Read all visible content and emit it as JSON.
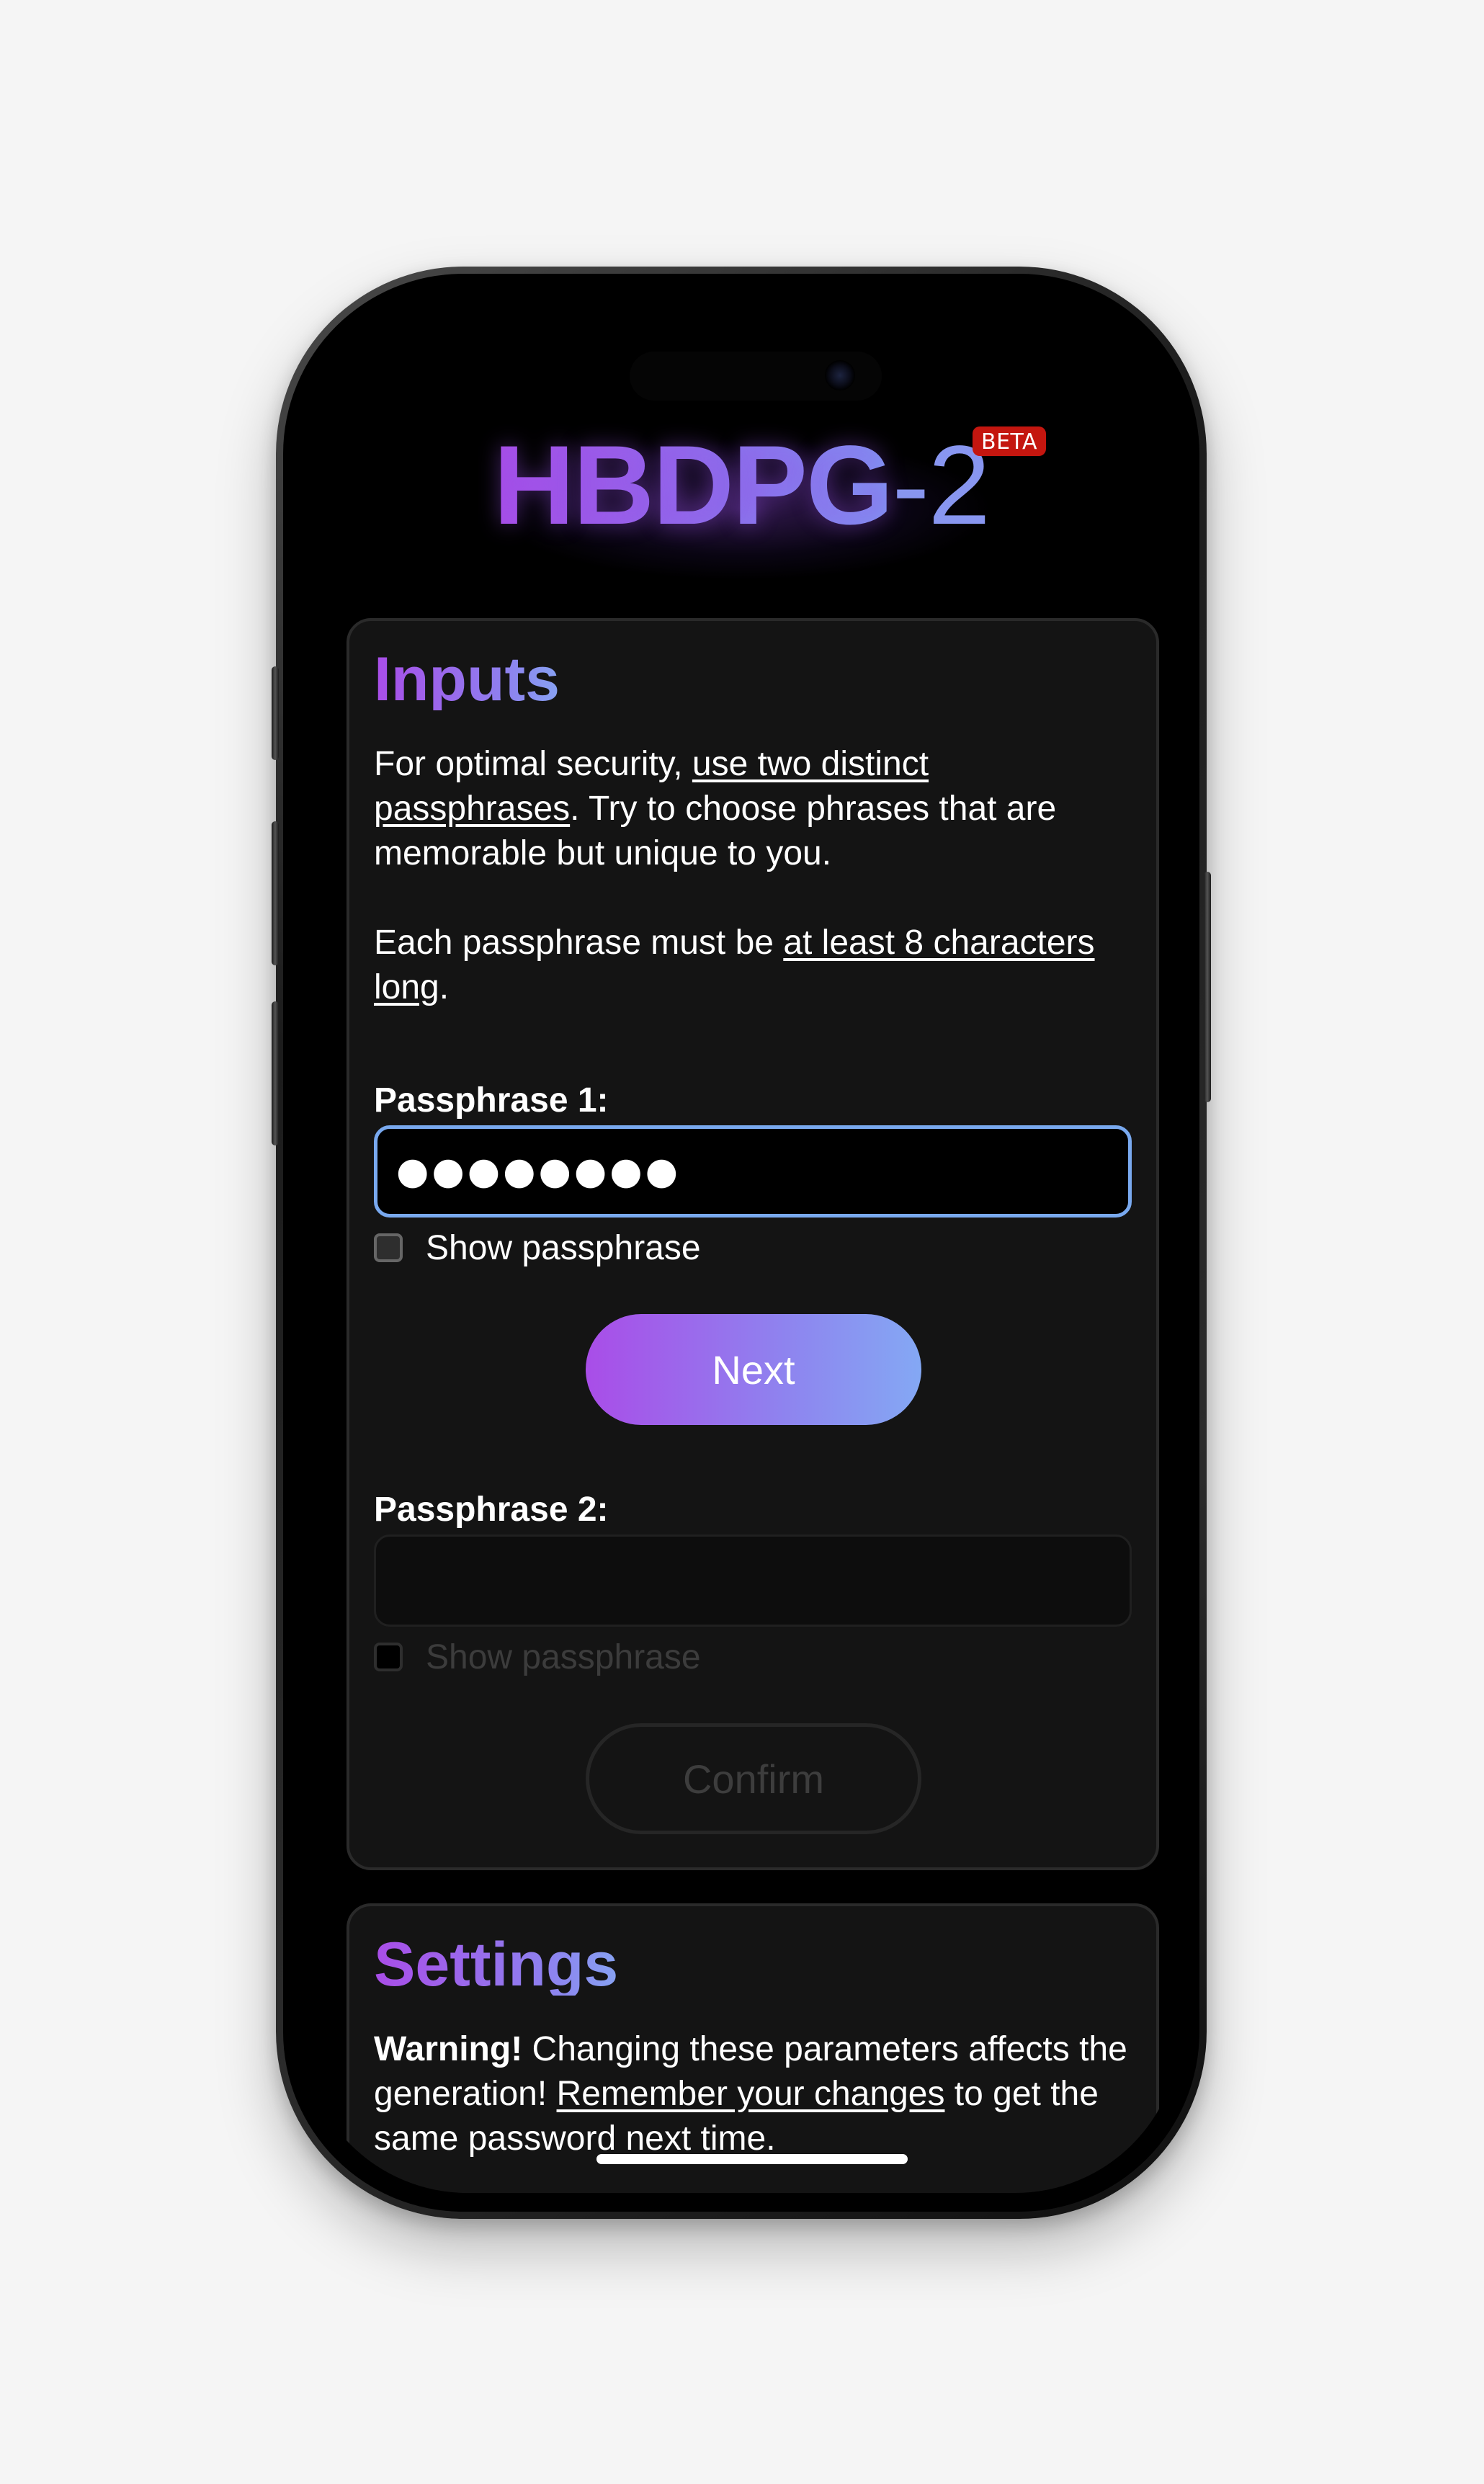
{
  "app": {
    "logo_main": "HBDPG",
    "logo_suffix": "-2",
    "badge": "BETA"
  },
  "inputs_card": {
    "title": "Inputs",
    "intro_prefix": "For optimal security, ",
    "intro_link": "use two distinct passphrases",
    "intro_suffix": ". Try to choose phrases that are memorable but unique to you.",
    "length_prefix": "Each passphrase must be ",
    "length_link": "at least 8 characters long",
    "length_suffix": ".",
    "passphrase1": {
      "label": "Passphrase 1:",
      "value": "●●●●●●●●",
      "show_label": "Show passphrase"
    },
    "next_button": "Next",
    "passphrase2": {
      "label": "Passphrase 2:",
      "value": "",
      "show_label": "Show passphrase"
    },
    "confirm_button": "Confirm"
  },
  "settings_card": {
    "title": "Settings",
    "warning_bold": "Warning!",
    "warning_text": " Changing these parameters affects the generation! ",
    "warning_link": "Remember your changes",
    "warning_suffix": " to get the same password next time."
  },
  "colors": {
    "accent_purple": "#a94de8",
    "accent_blue": "#84a8f4",
    "badge_red": "#c4160f",
    "focus_border": "#79a9ef"
  }
}
